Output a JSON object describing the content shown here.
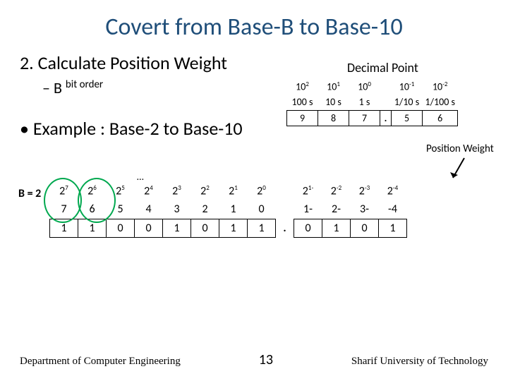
{
  "title": "Covert from Base-B to Base-10",
  "section_no": "2.",
  "section_text": "Calculate Position Weight",
  "sub_dash": "–",
  "sub_B": "B",
  "sub_bitorder": "bit order",
  "decimal_point_label": "Decimal Point",
  "dec": {
    "p": [
      "10",
      "10",
      "10",
      "10",
      "10"
    ],
    "pe": [
      "2",
      "1",
      "0",
      "-1",
      "-2"
    ],
    "n": [
      "100 s",
      "10 s",
      "1 s",
      "1/10 s",
      "1/100 s"
    ],
    "d": [
      "9",
      "8",
      "7",
      ".",
      "5",
      "6"
    ]
  },
  "bullet": "• Example : Base-2 to Base-10",
  "posw": "Position Weight",
  "Bequals": "B = 2",
  "dots": "…",
  "big": {
    "pow_base": "2",
    "pow_exp": [
      "7",
      "6",
      "5",
      "4",
      "3",
      "2",
      "1",
      "0",
      "1-",
      "-2",
      "-3",
      "-4"
    ],
    "idx": [
      "7",
      "6",
      "5",
      "4",
      "3",
      "2",
      "1",
      "0",
      "1-",
      "2-",
      "3-",
      "-4"
    ],
    "digits": [
      "1",
      "1",
      "0",
      "0",
      "1",
      "0",
      "1",
      "1",
      ".",
      "0",
      "1",
      "0",
      "1"
    ]
  },
  "footer": {
    "left": "Department of Computer Engineering",
    "page": "13",
    "right": "Sharif University of Technology"
  }
}
